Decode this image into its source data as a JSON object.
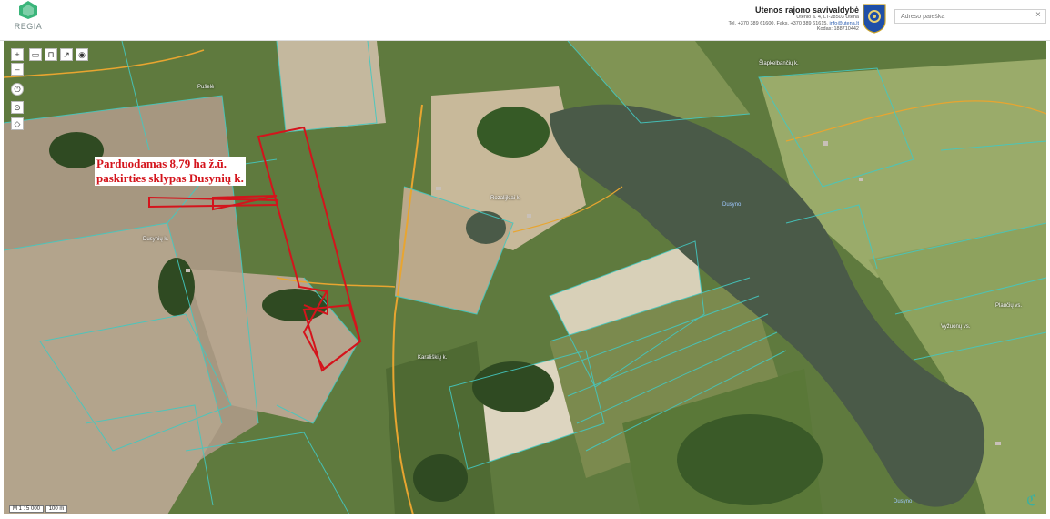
{
  "header": {
    "logo_text": "REGIA",
    "muni_title": "Utenos rajono savivaldybė",
    "muni_address": "Utenio a. 4, LT-28503 Utena",
    "muni_contacts": "Tel. +370 389 61600, Faks. +370 389 61615,",
    "muni_email": "info@utena.lt",
    "muni_code": "Kodas: 188710442",
    "search_placeholder": "Adreso paieška",
    "search_clear": "×"
  },
  "toolbar": {
    "zoom_in": "+",
    "zoom_out": "–"
  },
  "map": {
    "sale_label_line1": "Parduodamas 8,79 ha ž.ū.",
    "sale_label_line2": "paskirties sklypas Dusynių k.",
    "places": [
      {
        "name": "Pušelė"
      },
      {
        "name": "Dusynių k."
      },
      {
        "name": "Rozalijkiai k."
      },
      {
        "name": "Karališkių k."
      },
      {
        "name": "Šlapkelbančių k."
      },
      {
        "name": "Dusyno"
      },
      {
        "name": "Vyžuonų vs."
      },
      {
        "name": "Plaučių vs."
      },
      {
        "name": "Dusyno"
      }
    ],
    "scale": "M 1 : 5 000",
    "scale_bar": "100 m",
    "colors": {
      "highlight": "#d4141c",
      "cadastre": "#44c8c0",
      "road": "#e8a530",
      "lake": "#4a5a48"
    }
  }
}
